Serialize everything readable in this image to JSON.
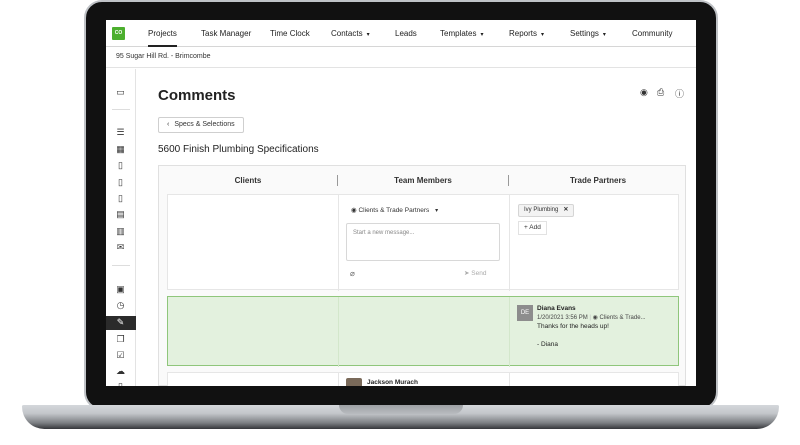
{
  "nav": {
    "logo": "CO",
    "items": [
      {
        "label": "Projects",
        "active": true,
        "dropdown": false
      },
      {
        "label": "Task Manager",
        "dropdown": false
      },
      {
        "label": "Time Clock",
        "dropdown": false
      },
      {
        "label": "Contacts",
        "dropdown": true
      },
      {
        "label": "Leads",
        "dropdown": false
      },
      {
        "label": "Templates",
        "dropdown": true
      },
      {
        "label": "Reports",
        "dropdown": true
      },
      {
        "label": "Settings",
        "dropdown": true
      },
      {
        "label": "Community",
        "dropdown": false
      }
    ]
  },
  "project": {
    "address": "95 Sugar Hill Rd. - Brimcombe"
  },
  "page": {
    "title": "Comments",
    "back_label": "Specs & Selections",
    "spec_title": "5600 Finish Plumbing Specifications",
    "header_icons": [
      "eye-icon",
      "print-icon",
      "help-icon"
    ]
  },
  "columns": {
    "clients": "Clients",
    "team": "Team Members",
    "trade": "Trade Partners"
  },
  "composer": {
    "visibility": "Clients & Trade Partners",
    "placeholder": "Start a new message...",
    "send_label": "Send",
    "recipient_chip": "Ivy Plumbing",
    "add_label": "Add"
  },
  "messages": [
    {
      "initials": "DE",
      "author": "Diana Evans",
      "timestamp": "1/20/2021 3:56 PM",
      "visibility": "Clients & Trade...",
      "text": "Thanks for the heads up!",
      "signature": "- Diana"
    },
    {
      "author": "Jackson Murach"
    }
  ],
  "colors": {
    "brand": "#4caf2e",
    "highlight_row": "#e3f1de",
    "highlight_border": "#8fc67b"
  }
}
